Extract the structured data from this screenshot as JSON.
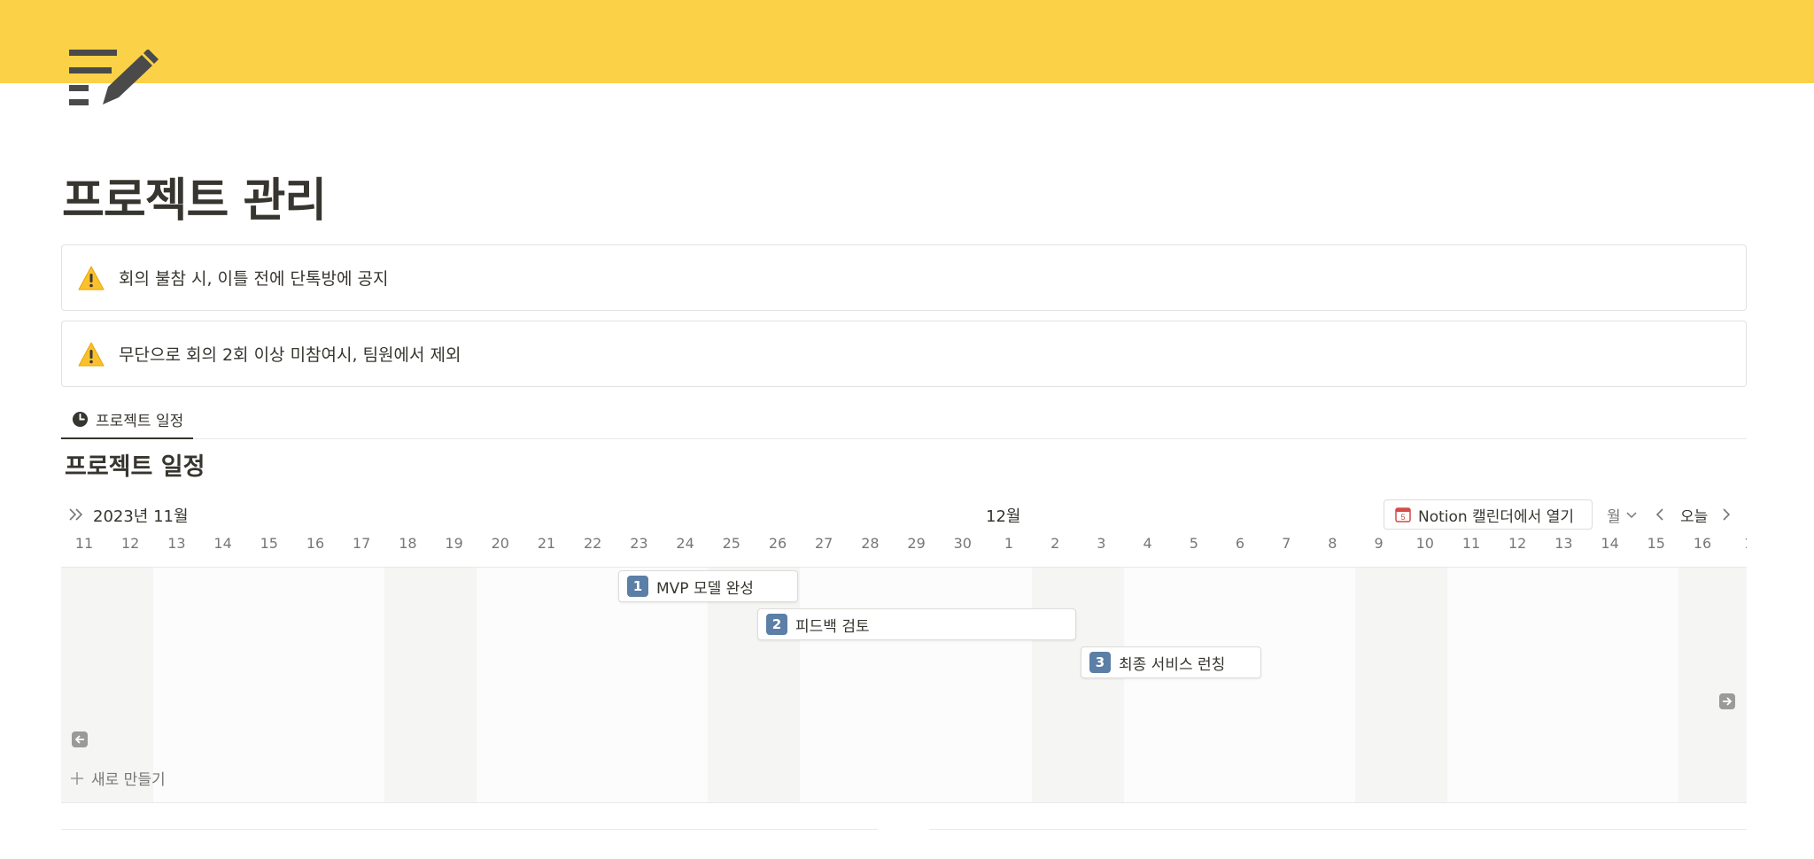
{
  "page": {
    "title": "프로젝트 관리",
    "icon": "notepad-pencil-icon",
    "cover_color": "#fbd148"
  },
  "callouts": [
    {
      "icon": "warning-icon",
      "text": "회의 불참 시, 이틀 전에 단톡방에 공지"
    },
    {
      "icon": "warning-icon",
      "text": "무단으로 회의 2회 이상 미참여시, 팀원에서 제외"
    }
  ],
  "tabs": [
    {
      "icon": "clock-icon",
      "label": "프로젝트 일정"
    }
  ],
  "timeline": {
    "title": "프로젝트 일정",
    "month_left": "2023년 11월",
    "month_mid": "12월",
    "open_calendar_label": "Notion 캘린더에서 열기",
    "calendar_icon_day": "5",
    "view_label": "월",
    "today_label": "오늘",
    "days": [
      "11",
      "12",
      "13",
      "14",
      "15",
      "16",
      "17",
      "18",
      "19",
      "20",
      "21",
      "22",
      "23",
      "24",
      "25",
      "26",
      "27",
      "28",
      "29",
      "30",
      "1",
      "2",
      "3",
      "4",
      "5",
      "6",
      "7",
      "8",
      "9",
      "10",
      "11",
      "12",
      "13",
      "14",
      "15",
      "16",
      "1"
    ],
    "items": [
      {
        "badge": "1",
        "label": "MVP 모델 완성"
      },
      {
        "badge": "2",
        "label": "피드백 검토"
      },
      {
        "badge": "3",
        "label": "최종 서비스 런칭"
      }
    ],
    "new_label": "새로 만들기"
  },
  "colors": {
    "accent_yellow": "#fbd148",
    "badge_blue": "#5b7fa6",
    "text": "#37352f",
    "muted": "#787774"
  }
}
